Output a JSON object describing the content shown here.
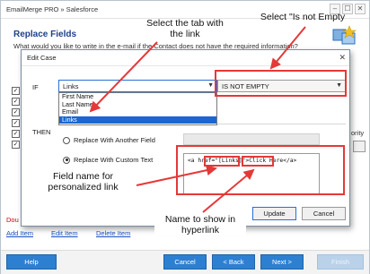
{
  "app": {
    "window_title": "EmailMerge PRO » Salesforce",
    "minimize_glyph": "–",
    "maximize_glyph": "☐",
    "close_glyph": "✕"
  },
  "background": {
    "section_title": "Replace Fields",
    "question": "What would you like to write in the e-mail if the Contact does not have the required information?",
    "priority_fragment": "ority",
    "double_fragment": "Dou",
    "links": {
      "add_item": "Add Item",
      "edit_item": "Edit Item",
      "delete_item": "Delete Item"
    },
    "footer": {
      "help": "Help",
      "cancel": "Cancel",
      "back": "< Back",
      "next": "Next >",
      "finish": "Finish"
    }
  },
  "dialog": {
    "title": "Edit Case",
    "close_glyph": "✕",
    "if_label": "IF",
    "then_label": "THEN",
    "field_select": {
      "value": "Links",
      "options": [
        "First Name",
        "Last Name",
        "Email",
        "Links"
      ],
      "selected": "Links"
    },
    "operator_select": {
      "value": "IS NOT EMPTY"
    },
    "option_another_field": "Replace With Another Field",
    "option_custom_text": "Replace With Custom Text",
    "custom_text": "<a href=\"[Links]\">Click Here</a>",
    "update_button": "Update",
    "cancel_button": "Cancel"
  },
  "annotations": {
    "select_tab": "Select the tab with the link",
    "select_not_empty": "Select \"Is not Empty",
    "field_name": "Field name for personalized link",
    "name_to_show": "Name to show in hyperlink",
    "accent_color": "#e53838"
  },
  "colors": {
    "accent_blue": "#2d7fd1",
    "title_blue": "#1f3f8a",
    "link_blue": "#1a4fc4",
    "selection_blue": "#1b66d1"
  }
}
